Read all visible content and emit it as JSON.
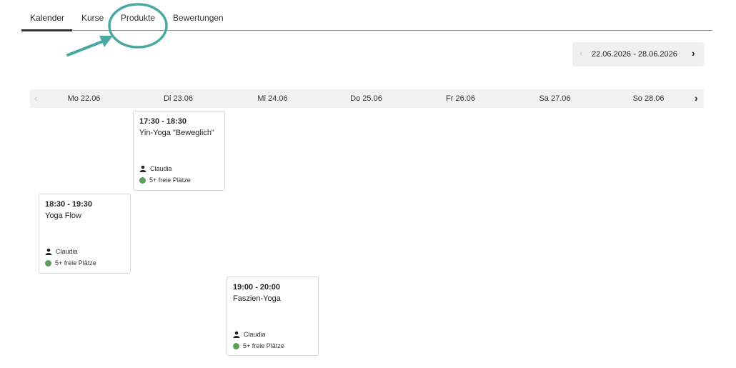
{
  "tabs": [
    {
      "label": "Kalender",
      "active": true
    },
    {
      "label": "Kurse",
      "active": false
    },
    {
      "label": "Produkte",
      "active": false
    },
    {
      "label": "Bewertungen",
      "active": false
    }
  ],
  "annotation": {
    "color": "#4aa8a4",
    "target": "Produkte"
  },
  "date_range": {
    "text": "22.06.2026  -  28.06.2026"
  },
  "days": [
    "Mo 22.06",
    "Di 23.06",
    "Mi 24.06",
    "Do 25.06",
    "Fr 26.06",
    "Sa 27.06",
    "So 28.06"
  ],
  "events": [
    {
      "time": "17:30 - 18:30",
      "name": "Yin-Yoga \"Beweglich\"",
      "trainer": "Claudia",
      "spots": "5+ freie Plätze"
    },
    {
      "time": "18:30 - 19:30",
      "name": "Yoga Flow",
      "trainer": "Claudia",
      "spots": "5+ freie Plätze"
    },
    {
      "time": "19:00 - 20:00",
      "name": "Faszien-Yoga",
      "trainer": "Claudia",
      "spots": "5+ freie Plätze"
    }
  ],
  "colors": {
    "availability_dot": "#5aa05a",
    "annotation": "#4aa8a4"
  },
  "icons": {
    "prev": "chevron-left-icon",
    "next": "chevron-right-icon",
    "trainer": "person-icon",
    "availability": "green-dot-icon"
  }
}
